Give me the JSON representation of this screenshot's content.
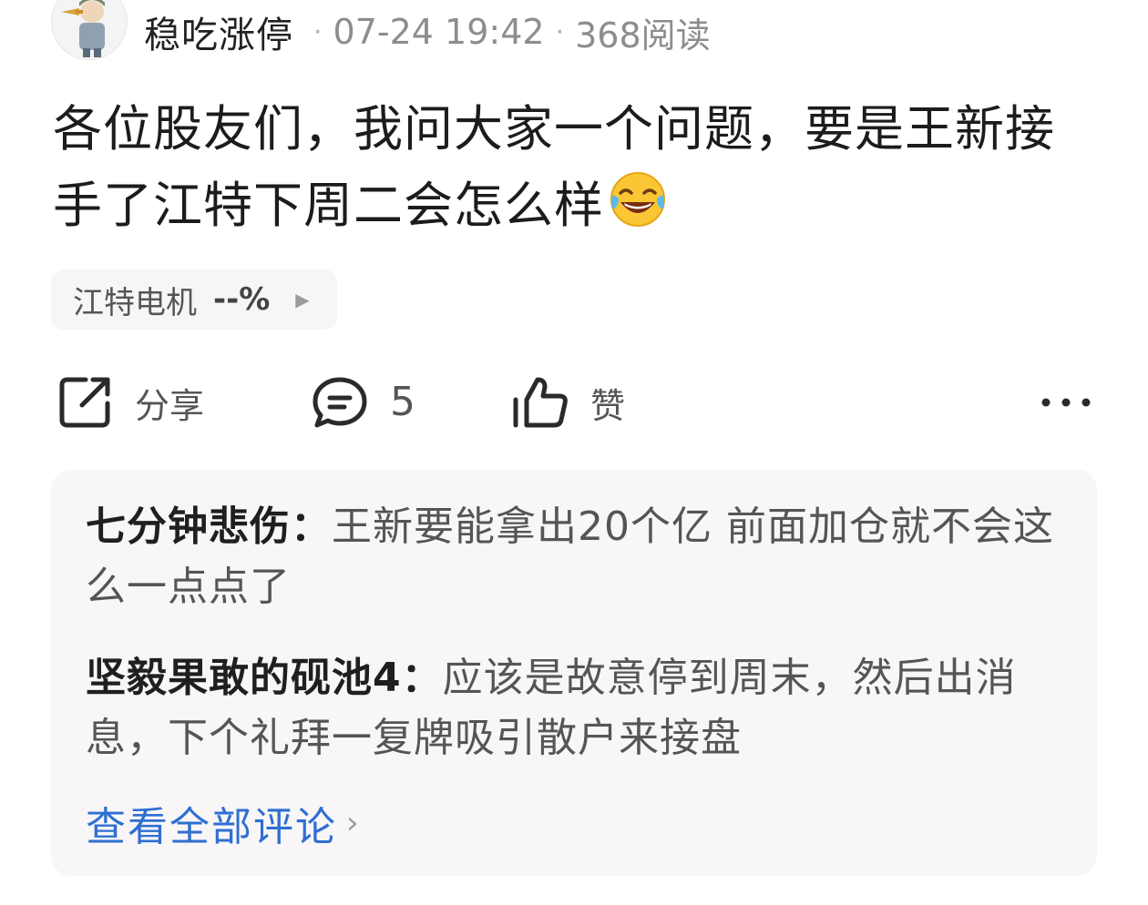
{
  "header": {
    "author": "稳吃涨停",
    "date": "07-24 19:42",
    "reads": "368阅读",
    "separator": "·"
  },
  "post": {
    "text": "各位股友们，我问大家一个问题，要是王新接手了江特下周二会怎么样",
    "emoji": "laughing-crying-emoji"
  },
  "stock": {
    "name": "江特电机",
    "change": "--%"
  },
  "actions": {
    "share_label": "分享",
    "comment_count": "5",
    "like_label": "赞"
  },
  "comments": [
    {
      "name": "七分钟悲伤：",
      "text": "王新要能拿出20个亿 前面加仓就不会这么一点点了"
    },
    {
      "name": "坚毅果敢的砚池4：",
      "text": "应该是故意停到周末，然后出消息，下个礼拜一复牌吸引散户来接盘"
    }
  ],
  "view_all": "查看全部评论",
  "colors": {
    "link": "#2e6fd1",
    "comment_bg": "#f8f6f7",
    "meta_gray": "#8d8d8d"
  }
}
